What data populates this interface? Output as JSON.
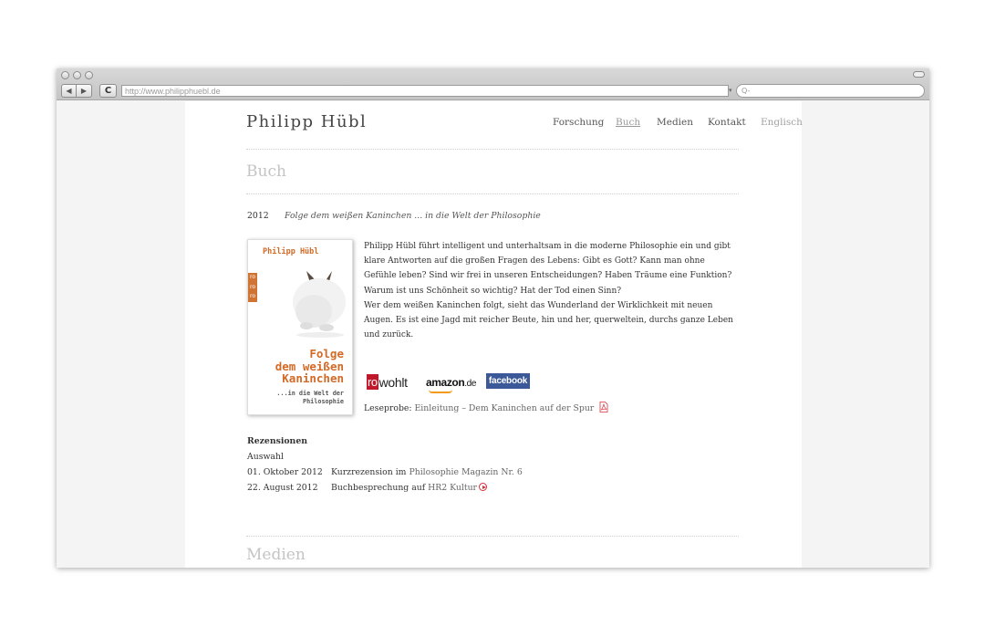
{
  "browser": {
    "url": "http://www.philipphuebl.de",
    "search_placeholder": "Q-",
    "back_glyph": "◀",
    "forward_glyph": "▶",
    "reload_glyph": "C"
  },
  "site": {
    "name": "Philipp Hübl",
    "nav": [
      "Forschung",
      "Buch",
      "Medien",
      "Kontakt",
      "Englisch"
    ],
    "active_nav": "Buch"
  },
  "book_section": {
    "title": "Buch",
    "year": "2012",
    "book_title": "Folge dem weißen Kaninchen ... in die Welt der Philosophie",
    "cover": {
      "author": "Philipp Hübl",
      "publisher_mark": "ro ro ro",
      "title_lines": [
        "Folge",
        "dem weißen",
        "Kaninchen"
      ],
      "subtitle_lines": [
        "...in die Welt der",
        "Philosophie"
      ]
    },
    "description_p1": "Philipp Hübl führt intelligent und unterhaltsam in die moderne Philosophie ein und gibt klare Antworten auf die großen Fragen des Lebens: Gibt es Gott? Kann man ohne Gefühle leben? Sind wir frei in unseren Entscheidungen? Haben Träume eine Funktion? Warum ist uns Schönheit so wichtig? Hat der Tod einen Sinn?",
    "description_p2": "Wer dem weißen Kaninchen folgt, sieht das Wunderland der Wirklichkeit mit neuen Augen. Es ist eine Jagd mit reicher Beute, hin und her, querweltein, durchs ganze Leben und zurück.",
    "logos": {
      "rowohlt_ro": "ro",
      "rowohlt_rest": "wohlt",
      "amazon": "amazon",
      "amazon_tld": ".de",
      "facebook": "facebook"
    },
    "leseprobe_label": "Leseprobe:",
    "leseprobe_link": "Einleitung – Dem Kaninchen auf der Spur",
    "reviews_heading": "Rezensionen",
    "reviews_sub": "Auswahl",
    "reviews": [
      {
        "date": "01. Oktober 2012",
        "type": "Kurzrezension im",
        "source": "Philosophie Magazin Nr. 6"
      },
      {
        "date": "22. August 2012",
        "type": "Buchbesprechung auf",
        "source": "HR2 Kultur"
      }
    ]
  },
  "media_section": {
    "title": "Medien"
  },
  "colors": {
    "accent_orange": "#d26a26",
    "rowohlt_red": "#c0182a",
    "facebook_blue": "#3b5998",
    "amazon_orange": "#f29a1a",
    "pdf_red": "#d9303a"
  }
}
